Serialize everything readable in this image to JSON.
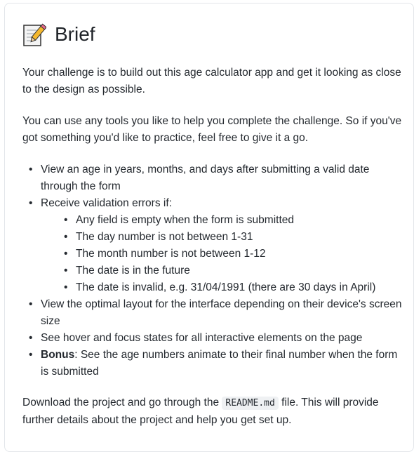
{
  "heading": {
    "icon": "memo-icon",
    "title": "Brief"
  },
  "paragraphs": [
    "Your challenge is to build out this age calculator app and get it looking as close to the design as possible.",
    "You can use any tools you like to help you complete the challenge. So if you've got something you'd like to practice, feel free to give it a go."
  ],
  "list": {
    "item1": "View an age in years, months, and days after submitting a valid date through the form",
    "item2": "Receive validation errors if:",
    "sub": [
      "Any field is empty when the form is submitted",
      "The day number is not between 1-31",
      "The month number is not between 1-12",
      "The date is in the future",
      "The date is invalid, e.g. 31/04/1991 (there are 30 days in April)"
    ],
    "item3": "View the optimal layout for the interface depending on their device's screen size",
    "item4": "See hover and focus states for all interactive elements on the page",
    "item5_bold": "Bonus",
    "item5_rest": ": See the age numbers animate to their final number when the form is submitted"
  },
  "footer": {
    "before": "Download the project and go through the ",
    "code": "README.md",
    "after": " file. This will provide further details about the project and help you get set up."
  }
}
